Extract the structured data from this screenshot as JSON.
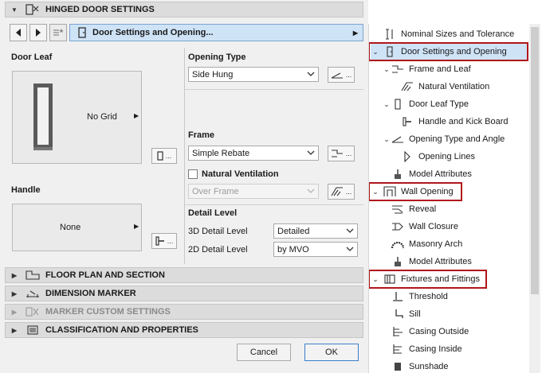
{
  "header": {
    "title": "HINGED DOOR SETTINGS"
  },
  "nav": {
    "current_page": "Door Settings and Opening..."
  },
  "door_leaf": {
    "label": "Door Leaf",
    "preview_text": "No Grid"
  },
  "handle": {
    "label": "Handle",
    "preview_text": "None"
  },
  "opening_type": {
    "label": "Opening Type",
    "value": "Side Hung"
  },
  "frame": {
    "label": "Frame",
    "value": "Simple Rebate"
  },
  "natural_ventilation": {
    "label": "Natural Ventilation",
    "checked": false,
    "value": "Over Frame"
  },
  "detail_level": {
    "label": "Detail Level",
    "rows": [
      {
        "label": "3D Detail Level",
        "value": "Detailed"
      },
      {
        "label": "2D Detail Level",
        "value": "by MVO"
      }
    ]
  },
  "sections": [
    {
      "label": "FLOOR PLAN AND SECTION",
      "disabled": false
    },
    {
      "label": "DIMENSION MARKER",
      "disabled": false
    },
    {
      "label": "MARKER CUSTOM SETTINGS",
      "disabled": true
    },
    {
      "label": "CLASSIFICATION AND PROPERTIES",
      "disabled": false
    }
  ],
  "buttons": {
    "cancel": "Cancel",
    "ok": "OK",
    "more": "..."
  },
  "tree": {
    "items": [
      {
        "label": "Nominal Sizes and Tolerance",
        "icon": "nominal-sizes-icon"
      },
      {
        "label": "Door Settings and Opening",
        "icon": "door-settings-icon"
      },
      {
        "label": "Frame and Leaf",
        "icon": "frame-leaf-icon"
      },
      {
        "label": "Natural Ventilation",
        "icon": "ventilation-icon"
      },
      {
        "label": "Door Leaf Type",
        "icon": "door-leaf-type-icon"
      },
      {
        "label": "Handle and Kick Board",
        "icon": "handle-icon"
      },
      {
        "label": "Opening Type and Angle",
        "icon": "opening-angle-icon"
      },
      {
        "label": "Opening Lines",
        "icon": "opening-lines-icon"
      },
      {
        "label": "Model Attributes",
        "icon": "brush-icon"
      },
      {
        "label": "Wall Opening",
        "icon": "wall-opening-icon"
      },
      {
        "label": "Reveal",
        "icon": "reveal-icon"
      },
      {
        "label": "Wall Closure",
        "icon": "wall-closure-icon"
      },
      {
        "label": "Masonry Arch",
        "icon": "masonry-arch-icon"
      },
      {
        "label": "Model Attributes",
        "icon": "brush-icon"
      },
      {
        "label": "Fixtures and Fittings",
        "icon": "fixtures-icon"
      },
      {
        "label": "Threshold",
        "icon": "threshold-icon"
      },
      {
        "label": "Sill",
        "icon": "sill-icon"
      },
      {
        "label": "Casing Outside",
        "icon": "casing-outside-icon"
      },
      {
        "label": "Casing Inside",
        "icon": "casing-inside-icon"
      },
      {
        "label": "Sunshade",
        "icon": "sunshade-icon"
      }
    ]
  },
  "colors": {
    "highlight": "#b0161c",
    "selection": "#cfe3f7",
    "accent": "#3b7ecb"
  }
}
